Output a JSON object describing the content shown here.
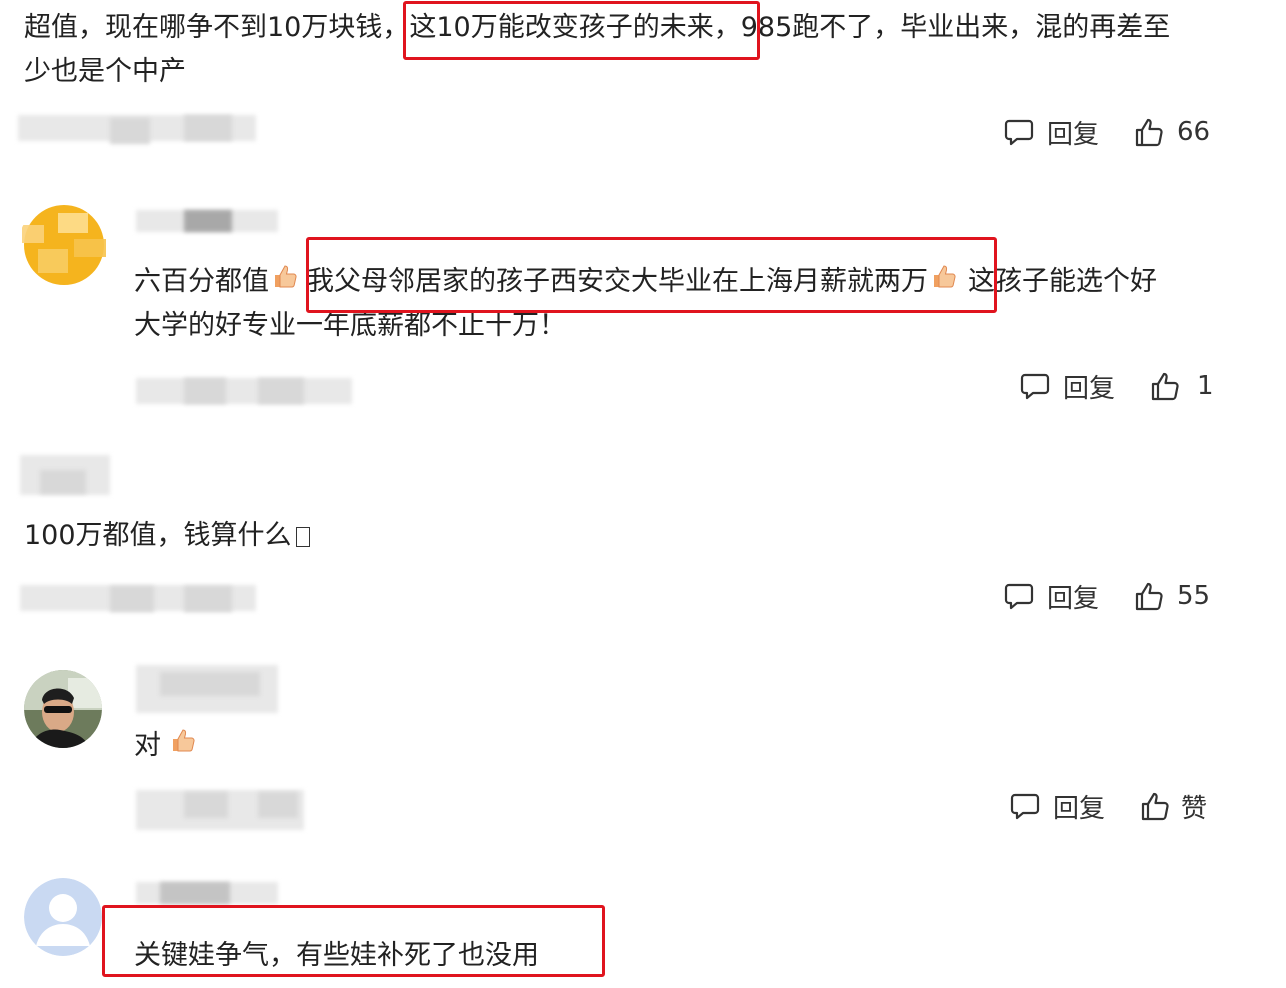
{
  "comments": [
    {
      "id": "c1",
      "text_parts": [
        "超值，现在哪争不到10万块钱",
        "，",
        "这10万能改变孩子的未来，",
        "985跑不了，毕业出来，混的再差至"
      ],
      "text_line2": "少也是个中产",
      "reply_label": "回复",
      "likes": "66"
    },
    {
      "id": "c2",
      "text_a": "六百分都值",
      "text_highlight": "我父母邻居家的孩子西安交大毕业在上海月薪就两万",
      "text_b": "这孩子能选个好",
      "text_line2": "大学的好专业一年底薪都不止十万！",
      "reply_label": "回复",
      "likes": "1"
    },
    {
      "id": "c3",
      "text": "100万都值，钱算什么",
      "reply_label": "回复",
      "likes": "55"
    },
    {
      "id": "c4",
      "text": "对",
      "reply_label": "回复",
      "likes": "赞"
    },
    {
      "id": "c5",
      "text": "关键娃争气，有些娃补死了也没用"
    }
  ],
  "icons": {
    "reply": "comment-bubble-icon",
    "like": "thumbs-up-icon",
    "emoji": "thumbs-up-emoji-icon"
  },
  "colors": {
    "highlight_border": "#e0141e",
    "text": "#222222",
    "avatar_yellow": "#f5b41e",
    "avatar_default": "#c9d9f2"
  }
}
